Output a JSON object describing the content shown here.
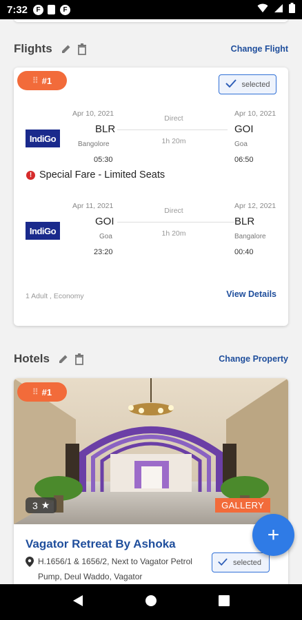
{
  "status_bar": {
    "time": "7:32",
    "left_icons": [
      "app-notification-icon",
      "sd-card-icon",
      "app-notification-icon"
    ],
    "right_icons": [
      "wifi-icon",
      "signal-icon",
      "battery-icon"
    ]
  },
  "flights": {
    "title": "Flights",
    "action_label": "Change Flight",
    "badge": "#1",
    "selected_label": "selected",
    "legs": [
      {
        "airline": "IndiGo",
        "dep_date": "Apr 10, 2021",
        "dep_code": "BLR",
        "dep_city": "Bangolore",
        "dep_time": "05:30",
        "type": "Direct",
        "duration": "1h 20m",
        "arr_date": "Apr 10, 2021",
        "arr_code": "GOI",
        "arr_city": "Goa",
        "arr_time": "06:50"
      },
      {
        "airline": "IndiGo",
        "dep_date": "Apr 11, 2021",
        "dep_code": "GOI",
        "dep_city": "Goa",
        "dep_time": "23:20",
        "type": "Direct",
        "duration": "1h 20m",
        "arr_date": "Apr 12, 2021",
        "arr_code": "BLR",
        "arr_city": "Bangalore",
        "arr_time": "00:40"
      }
    ],
    "notice": "Special Fare - Limited Seats",
    "passengers": "1 Adult , Economy",
    "view_details_label": "View Details"
  },
  "hotels": {
    "title": "Hotels",
    "action_label": "Change Property",
    "badge": "#1",
    "rating": "3",
    "gallery_label": "GALLERY",
    "name": "Vagator Retreat By Ashoka",
    "address": "H.1656/1 & 1656/2, Next to Vagator Petrol Pump, Deul Waddo, Vagator",
    "selected_label": "selected"
  },
  "fab_label": "+",
  "colors": {
    "accent_orange": "#f26b3a",
    "link_blue": "#1f4e9c",
    "fab_blue": "#2f7be6",
    "selected_border": "#2f6fd6"
  }
}
